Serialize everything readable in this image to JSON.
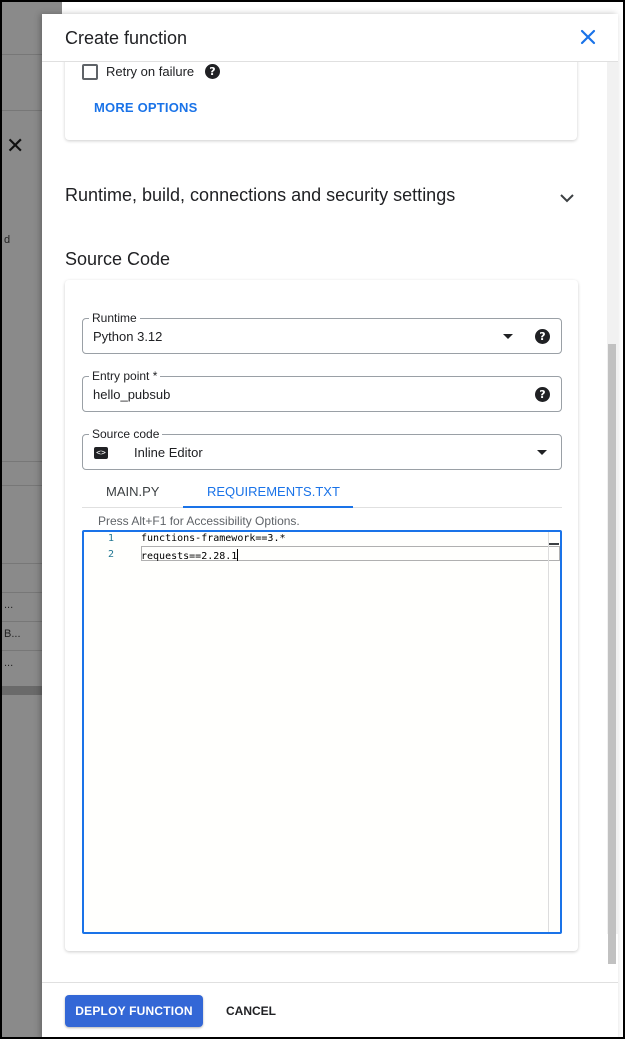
{
  "dialog": {
    "title": "Create function"
  },
  "backdrop": {
    "fragments": [
      "d",
      "...",
      "B...",
      "..."
    ]
  },
  "trigger_card": {
    "retry_label": "Retry on failure",
    "more_options": "MORE OPTIONS"
  },
  "runtime_section": {
    "title": "Runtime, build, connections and security settings"
  },
  "source": {
    "title": "Source Code",
    "runtime": {
      "label": "Runtime",
      "value": "Python 3.12"
    },
    "entry_point": {
      "label": "Entry point *",
      "value": "hello_pubsub"
    },
    "source_code": {
      "label": "Source code",
      "value": "Inline Editor"
    },
    "tabs": [
      {
        "label": "MAIN.PY",
        "active": false
      },
      {
        "label": "REQUIREMENTS.TXT",
        "active": true
      }
    ],
    "a11y_hint": "Press Alt+F1 for Accessibility Options.",
    "editor": {
      "lines": [
        {
          "num": "1",
          "text": "functions-framework==3.*"
        },
        {
          "num": "2",
          "text": "requests==2.28.1"
        }
      ]
    }
  },
  "footer": {
    "deploy": "DEPLOY FUNCTION",
    "cancel": "CANCEL"
  },
  "colors": {
    "accent": "#1a73e8",
    "primary_button": "#3367d6"
  },
  "icons": [
    "close-icon",
    "help-icon",
    "chevron-down-icon",
    "code-icon",
    "dropdown-caret-icon"
  ]
}
